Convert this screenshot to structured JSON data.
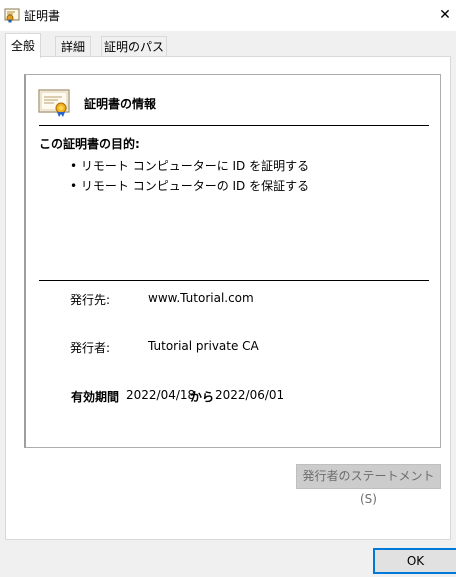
{
  "window": {
    "title": "証明書",
    "close_glyph": "✕"
  },
  "tabs": [
    {
      "label": "全般",
      "active": true
    },
    {
      "label": "詳細",
      "active": false
    },
    {
      "label": "証明のパス",
      "active": false
    }
  ],
  "info": {
    "title": "証明書の情報",
    "purpose_heading": "この証明書の目的:",
    "purposes": [
      "• リモート コンピューターに ID を証明する",
      "• リモート コンピューターの ID を保証する"
    ]
  },
  "fields": {
    "issued_to_label": "発行先:",
    "issued_to_value": "www.Tutorial.com",
    "issued_by_label": "発行者:",
    "issued_by_value": "Tutorial private CA",
    "validity_label": "有効期間",
    "valid_from": "2022/04/18",
    "from_word": "から",
    "valid_to": "2022/06/01"
  },
  "buttons": {
    "issuer_statement": "発行者のステートメント(S)",
    "ok": "OK"
  },
  "colors": {
    "accent": "#0078d7",
    "disabled_button": "#cccccc"
  },
  "icons": [
    "certificate-icon",
    "close-icon"
  ]
}
